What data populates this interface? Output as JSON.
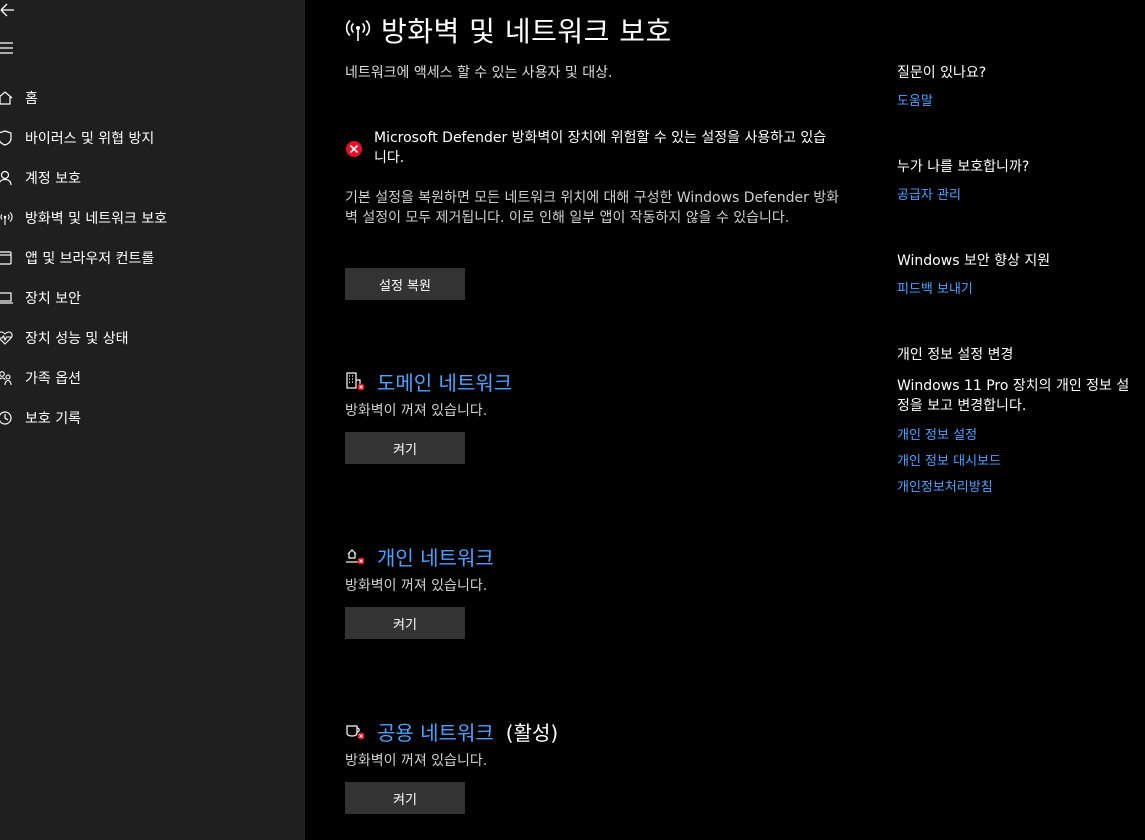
{
  "sidebar": {
    "back_icon": "back-arrow-icon",
    "menu_icon": "hamburger-menu-icon",
    "items": [
      {
        "label": "홈",
        "icon": "home-icon"
      },
      {
        "label": "바이러스 및 위협 방지",
        "icon": "shield-icon"
      },
      {
        "label": "계정 보호",
        "icon": "person-icon"
      },
      {
        "label": "방화벽 및 네트워크 보호",
        "icon": "antenna-icon"
      },
      {
        "label": "앱 및 브라우저 컨트롤",
        "icon": "app-window-icon"
      },
      {
        "label": "장치 보안",
        "icon": "laptop-icon"
      },
      {
        "label": "장치 성능 및 상태",
        "icon": "heart-pulse-icon"
      },
      {
        "label": "가족 옵션",
        "icon": "family-icon"
      },
      {
        "label": "보호 기록",
        "icon": "history-icon"
      }
    ]
  },
  "main": {
    "title": "방화벽 및 네트워크 보호",
    "subtitle": "네트워크에 액세스 할 수 있는 사용자 및 대상.",
    "warning": {
      "text": "Microsoft Defender 방화벽이 장치에 위험할 수 있는 설정을 사용하고 있습니다.",
      "description": "기본 설정을 복원하면 모든 네트워크 위치에 대해 구성한 Windows Defender 방화벽 설정이 모두 제거됩니다. 이로 인해 일부 앱이 작동하지 않을 수 있습니다.",
      "button": "설정 복원"
    },
    "networks": [
      {
        "name": "도메인 네트워크",
        "active": "",
        "status": "방화벽이 꺼져 있습니다.",
        "button": "켜기"
      },
      {
        "name": "개인 네트워크",
        "active": "",
        "status": "방화벽이 꺼져 있습니다.",
        "button": "켜기"
      },
      {
        "name": "공용 네트워크",
        "active": "(활성)",
        "status": "방화벽이 꺼져 있습니다.",
        "button": "켜기"
      }
    ]
  },
  "right": {
    "questions_heading": "질문이 있나요?",
    "help_link": "도움말",
    "protect_heading": "누가 나를 보호합니까?",
    "provider_link": "공급자 관리",
    "improve_heading": "Windows 보안 향상 지원",
    "feedback_link": "피드백 보내기",
    "privacy_heading": "개인 정보 설정 변경",
    "privacy_text": "Windows 11 Pro 장치의 개인 정보 설정을 보고 변경합니다.",
    "privacy_links": [
      "개인 정보 설정",
      "개인 정보 대시보드",
      "개인정보처리방침"
    ]
  },
  "colors": {
    "accent": "#4ea1ff",
    "sidebar_bg": "#1f1f1f",
    "button_bg": "#333333",
    "error_red": "#e81123"
  }
}
